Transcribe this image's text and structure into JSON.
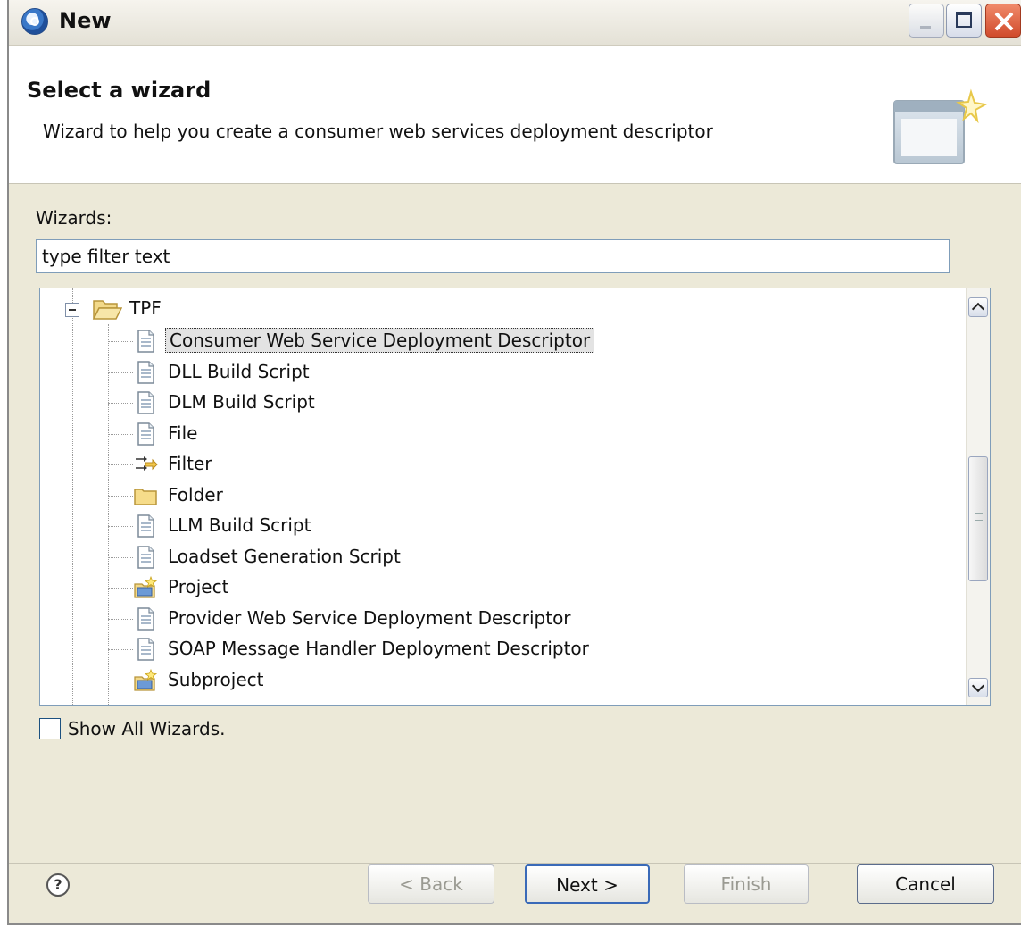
{
  "window": {
    "title": "New"
  },
  "header": {
    "title": "Select a wizard",
    "description": "Wizard to help you create a consumer web services deployment descriptor"
  },
  "wizards_label": "Wizards:",
  "filter": {
    "value": "type filter text"
  },
  "tree": {
    "root": "TPF",
    "items": [
      {
        "label": "Consumer Web Service Deployment Descriptor",
        "icon": "document-icon",
        "selected": true
      },
      {
        "label": "DLL Build Script",
        "icon": "document-icon"
      },
      {
        "label": "DLM Build Script",
        "icon": "document-icon"
      },
      {
        "label": "File",
        "icon": "document-icon"
      },
      {
        "label": "Filter",
        "icon": "filter-icon"
      },
      {
        "label": "Folder",
        "icon": "folder-icon"
      },
      {
        "label": "LLM Build Script",
        "icon": "document-icon"
      },
      {
        "label": "Loadset Generation Script",
        "icon": "document-icon"
      },
      {
        "label": "Project",
        "icon": "project-icon"
      },
      {
        "label": "Provider Web Service Deployment Descriptor",
        "icon": "document-icon"
      },
      {
        "label": "SOAP Message Handler Deployment Descriptor",
        "icon": "document-icon"
      },
      {
        "label": "Subproject",
        "icon": "project-icon"
      }
    ]
  },
  "show_all": {
    "label": "Show All Wizards.",
    "checked": false
  },
  "buttons": {
    "back": "< Back",
    "next": "Next >",
    "finish": "Finish",
    "cancel": "Cancel",
    "help": "?"
  },
  "colors": {
    "selection_bg": "#e3e3e3",
    "border": "#7f9db9",
    "dialog_bg": "#ece9d8"
  }
}
